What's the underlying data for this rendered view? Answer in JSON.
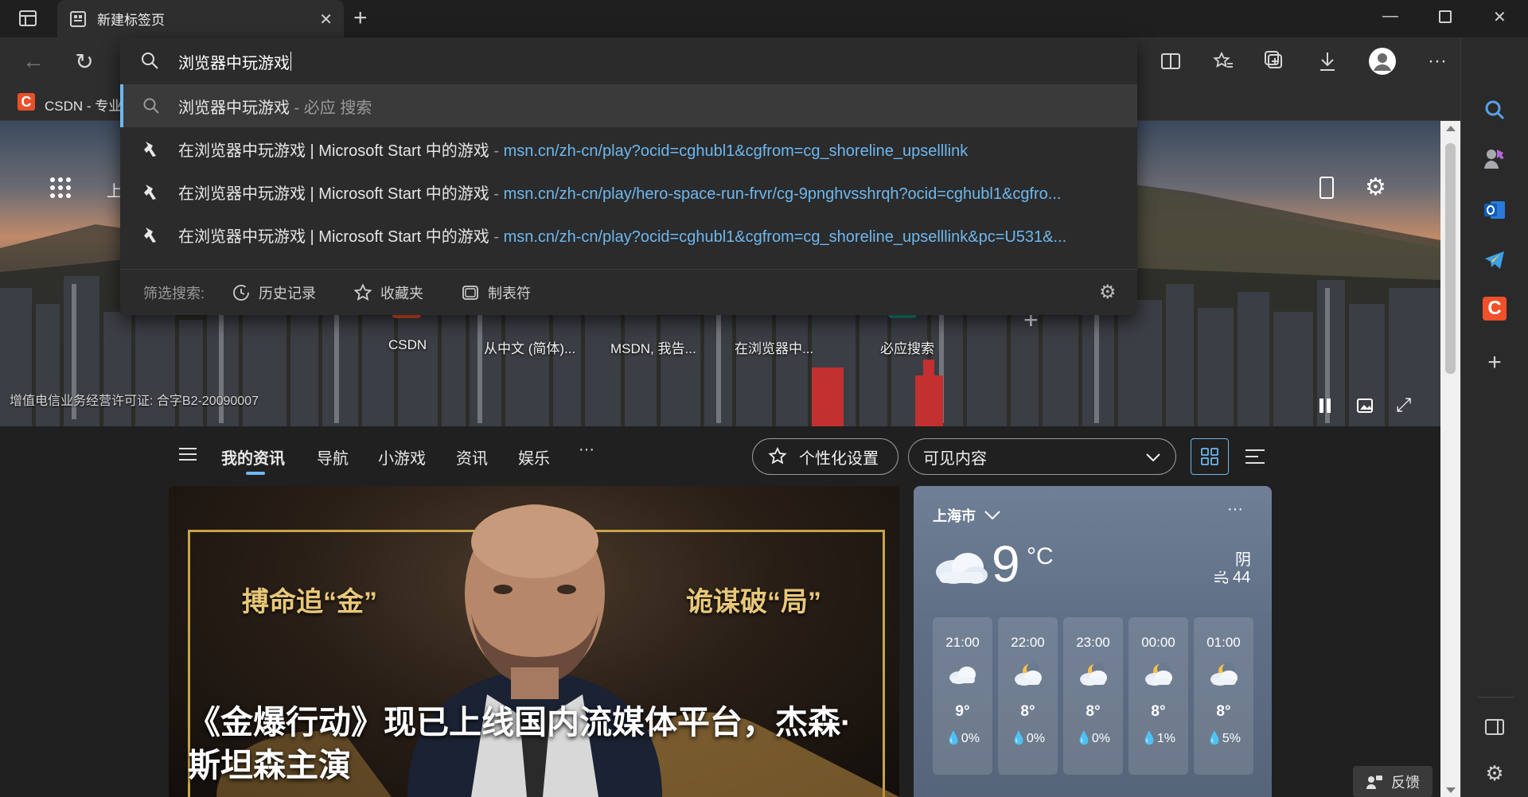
{
  "tab": {
    "title": "新建标签页"
  },
  "bookmarks": {
    "first_item": "CSDN - 专业"
  },
  "omnibox": {
    "query": "浏览器中玩游戏",
    "suggestions": [
      {
        "title": "浏览器中玩游戏",
        "suffix": " - 必应 搜索",
        "url": ""
      },
      {
        "title": "在浏览器中玩游戏 | Microsoft Start 中的游戏",
        "suffix": " - ",
        "url": "msn.cn/zh-cn/play?ocid=cghubl1&cgfrom=cg_shoreline_upselllink"
      },
      {
        "title": "在浏览器中玩游戏 | Microsoft Start 中的游戏",
        "suffix": " - ",
        "url": "msn.cn/zh-cn/play/hero-space-run-frvr/cg-9pnghvsshrqh?ocid=cghubl1&cgfro..."
      },
      {
        "title": "在浏览器中玩游戏 | Microsoft Start 中的游戏",
        "suffix": " - ",
        "url": "msn.cn/zh-cn/play?ocid=cghubl1&cgfrom=cg_shoreline_upselllink&pc=U531&..."
      }
    ],
    "filter": {
      "label": "筛选搜索:",
      "history": "历史记录",
      "favorites": "收藏夹",
      "tabs": "制表符"
    }
  },
  "banner": {
    "partial_nav": "上",
    "quicklinks": [
      "CSDN",
      "从中文 (简体)...",
      "MSDN, 我告...",
      "在浏览器中...",
      "必应搜索"
    ],
    "license": "增值电信业务经营许可证: 合字B2-20090007"
  },
  "news_nav": {
    "items": [
      "我的资讯",
      "导航",
      "小游戏",
      "资讯",
      "娱乐"
    ],
    "more": "···",
    "personalize": "个性化设置",
    "visible_content": "可见内容"
  },
  "hero": {
    "tagline_left": "搏命追“金”",
    "tagline_right": "诡谋破“局”",
    "headline": "《金爆行动》现已上线国内流媒体平台，杰森·斯坦森主演"
  },
  "weather": {
    "city": "上海市",
    "temp": "9",
    "unit": "°C",
    "condition": "阴",
    "aqi": "44",
    "more": "···",
    "hourly": [
      {
        "time": "21:00",
        "temp": "9°",
        "precip": "0%"
      },
      {
        "time": "22:00",
        "temp": "8°",
        "precip": "0%"
      },
      {
        "time": "23:00",
        "temp": "8°",
        "precip": "0%"
      },
      {
        "time": "00:00",
        "temp": "8°",
        "precip": "1%"
      },
      {
        "time": "01:00",
        "temp": "8°",
        "precip": "5%"
      }
    ]
  },
  "feedback": "反馈"
}
